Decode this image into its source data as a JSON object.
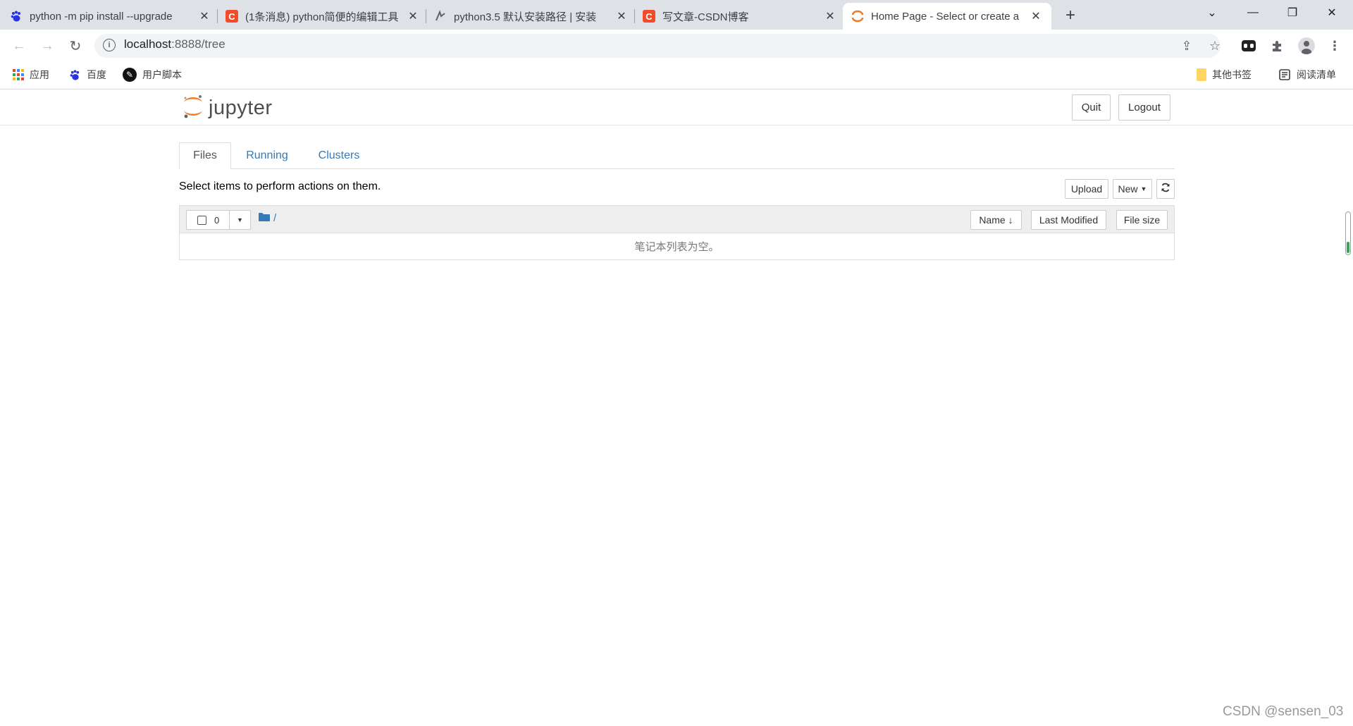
{
  "browser": {
    "tabs": [
      {
        "title": "python -m pip install --upgrade",
        "favicon": "baidu-paw-icon"
      },
      {
        "title": "(1条消息) python简便的编辑工具",
        "favicon": "csdn-icon"
      },
      {
        "title": "python3.5 默认安装路径 | 安装",
        "favicon": "gitee-icon"
      },
      {
        "title": "写文章-CSDN博客",
        "favicon": "csdn-icon"
      },
      {
        "title": "Home Page - Select or create a",
        "favicon": "jupyter-icon"
      }
    ],
    "csdn_letter": "C",
    "url_host": "localhost",
    "url_path": ":8888/tree",
    "bookmarks": [
      {
        "label": "应用"
      },
      {
        "label": "百度"
      },
      {
        "label": "用户脚本"
      }
    ],
    "other_bookmarks": "其他书签",
    "reading_list": "阅读清单"
  },
  "jupyter": {
    "logo_text": "jupyter",
    "quit_label": "Quit",
    "logout_label": "Logout",
    "tabs": [
      "Files",
      "Running",
      "Clusters"
    ],
    "instructions": "Select items to perform actions on them.",
    "upload_label": "Upload",
    "new_label": "New",
    "selected_count": "0",
    "breadcrumb": "/",
    "columns": {
      "name": "Name",
      "last_modified": "Last Modified",
      "file_size": "File size"
    },
    "empty_message": "笔记本列表为空。"
  },
  "watermark": "CSDN @sensen_03",
  "colors": {
    "link": "#337ab7",
    "jupyter_orange": "#f37726",
    "csdn_red": "#f04c2a"
  }
}
